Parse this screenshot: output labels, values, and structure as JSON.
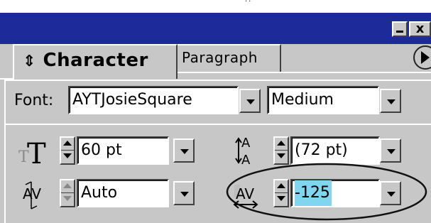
{
  "window": {
    "close_glyph": "x"
  },
  "tabs": {
    "active": {
      "label": "Character",
      "arrow": "⇕"
    },
    "inactive": {
      "label": "Paragraph"
    }
  },
  "font": {
    "label": "Font:",
    "family": "AYTJosieSquare",
    "style": "Medium"
  },
  "font_size": {
    "value": "60 pt",
    "icon_text": "T"
  },
  "leading": {
    "value": "(72 pt)",
    "icon_text_top": "A",
    "icon_text_bottom": "A"
  },
  "kerning": {
    "value": "Auto",
    "icon_text": "AV"
  },
  "tracking": {
    "value": "-125",
    "icon_text": "AV",
    "highlight_color": "#7fd6ee"
  },
  "colors": {
    "title_bar": "#1c2a9a",
    "panel": "#c7c7c7"
  }
}
